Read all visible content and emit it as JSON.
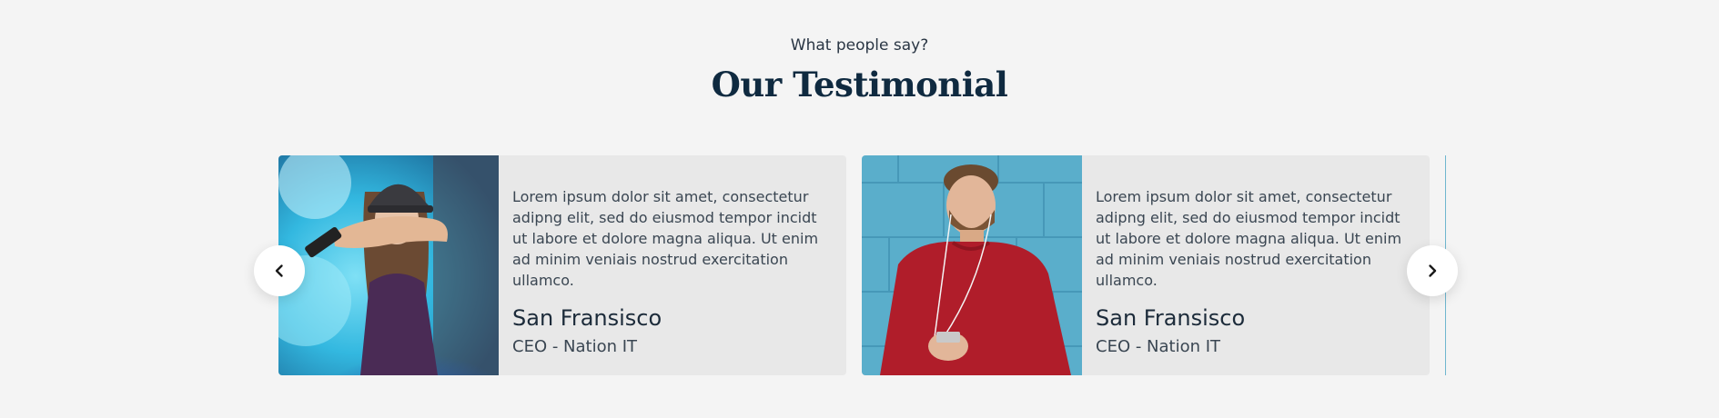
{
  "header": {
    "subtitle": "What people say?",
    "title": "Our Testimonial"
  },
  "testimonials": [
    {
      "quote": "Lorem ipsum dolor sit amet, consectetur adipng elit, sed do eiusmod tempor incidt ut labore et dolore magna aliqua. Ut enim ad minim veniais nostrud exercitation ullamco.",
      "name": "San Fransisco",
      "role": "CEO - Nation IT",
      "photo_icon": "woman-with-blue-smoke-photo"
    },
    {
      "quote": "Lorem ipsum dolor sit amet, consectetur adipng elit, sed do eiusmod tempor incidt ut labore et dolore magna aliqua. Ut enim ad minim veniais nostrud exercitation ullamco.",
      "name": "San Fransisco",
      "role": "CEO - Nation IT",
      "photo_icon": "man-in-red-sweater-photo"
    }
  ],
  "navigation": {
    "prev_icon": "chevron-left-icon",
    "next_icon": "chevron-right-icon"
  },
  "colors": {
    "background": "#f4f4f4",
    "card": "#e8e8e8",
    "title": "#0f2a40",
    "accent_blue": "#3fb7dc",
    "sweater_red": "#b01d2a"
  }
}
